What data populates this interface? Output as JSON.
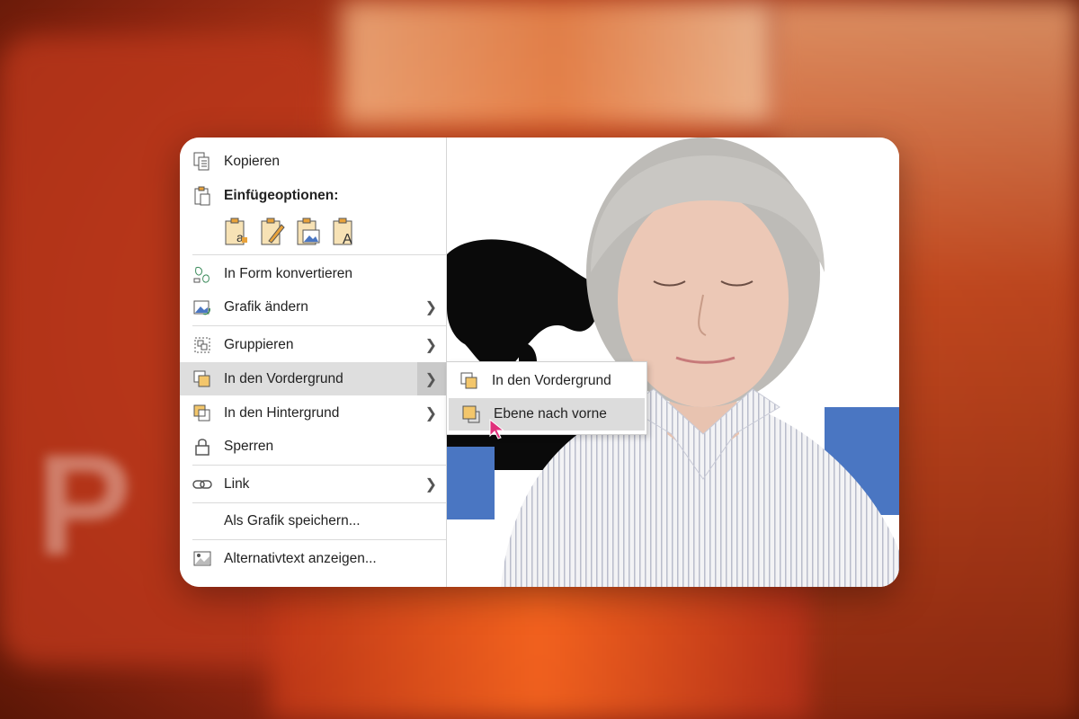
{
  "menu": {
    "items": [
      {
        "label": "Kopieren",
        "icon": "copy-icon"
      },
      {
        "label": "Einfügeoptionen:",
        "icon": "paste-icon"
      },
      {
        "label": "In Form konvertieren",
        "icon": "convert-shape-icon"
      },
      {
        "label": "Grafik ändern",
        "icon": "change-graphic-icon"
      },
      {
        "label": "Gruppieren",
        "icon": "group-icon"
      },
      {
        "label": "In den Vordergrund",
        "icon": "bring-forward-icon"
      },
      {
        "label": "In den Hintergrund",
        "icon": "send-backward-icon"
      },
      {
        "label": "Sperren",
        "icon": "lock-icon"
      },
      {
        "label": "Link",
        "icon": "link-icon"
      },
      {
        "label": "Als Grafik speichern...",
        "icon": ""
      },
      {
        "label": "Alternativtext anzeigen...",
        "icon": "alt-text-icon"
      }
    ],
    "paste_options": [
      "keep-text-only-icon",
      "paste-format-icon",
      "paste-picture-icon",
      "paste-text-icon"
    ]
  },
  "submenu": {
    "items": [
      {
        "label": "In den Vordergrund",
        "icon": "bring-to-front-icon"
      },
      {
        "label": "Ebene nach vorne",
        "icon": "bring-forward-one-icon"
      }
    ]
  },
  "colors": {
    "accent_blue": "#4a76c2",
    "icon_orange": "#e8a23a",
    "highlight": "#dedede",
    "cursor": "#e0307c"
  }
}
